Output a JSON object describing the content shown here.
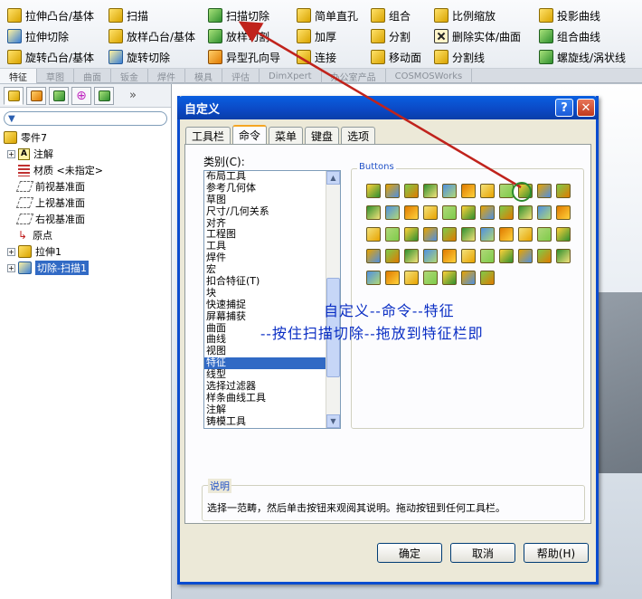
{
  "toolbar": {
    "col1": [
      "拉伸凸台/基体",
      "拉伸切除",
      "旋转凸台/基体"
    ],
    "col2": [
      "扫描",
      "放样凸台/基体",
      "旋转切除"
    ],
    "col3": [
      "扫描切除",
      "放样切割",
      "异型孔向导"
    ],
    "col4": [
      "简单直孔",
      "加厚",
      "连接"
    ],
    "col5": [
      "组合",
      "分割",
      "移动面"
    ],
    "col6": [
      "比例缩放",
      "删除实体/曲面",
      "分割线"
    ],
    "col7": [
      "投影曲线",
      "组合曲线",
      "螺旋线/涡状线"
    ]
  },
  "command_tabs": [
    "特征",
    "草图",
    "曲面",
    "钣金",
    "焊件",
    "模具",
    "评估",
    "DimXpert",
    "办公室产品",
    "COSMOSWorks"
  ],
  "tree": {
    "root": "零件7",
    "items": [
      "注解",
      "材质 <未指定>",
      "前视基准面",
      "上视基准面",
      "右视基准面",
      "原点",
      "拉伸1",
      "切除-扫描1"
    ]
  },
  "dialog": {
    "title": "自定义",
    "tabs": [
      "工具栏",
      "命令",
      "菜单",
      "键盘",
      "选项"
    ],
    "category_label": "类别(C):",
    "categories": [
      "布局工具",
      "参考几何体",
      "草图",
      "尺寸/几何关系",
      "对齐",
      "工程图",
      "工具",
      "焊件",
      "宏",
      "扣合特征(T)",
      "块",
      "快速捕捉",
      "屏幕捕获",
      "曲面",
      "曲线",
      "视图",
      "特征",
      "线型",
      "选择过滤器",
      "样条曲线工具",
      "注解",
      "铸模工具"
    ],
    "selected_category": "特征",
    "buttons_label": "Buttons",
    "instruction": "选择一范畴，然后单击按钮来观阅其说明。拖动按钮到任何工具栏。",
    "description_label": "说明",
    "ok": "确定",
    "cancel": "取消",
    "help": "帮助(H)"
  },
  "annotation": {
    "line1": "自定义--命令--特征",
    "line2": "--按住扫描切除--拖放到特征栏即"
  },
  "colors": {
    "title_bar": "#0b48c4",
    "annotation": "#0a2ec4",
    "arrow": "#c0231c",
    "selection": "#316ac5"
  }
}
